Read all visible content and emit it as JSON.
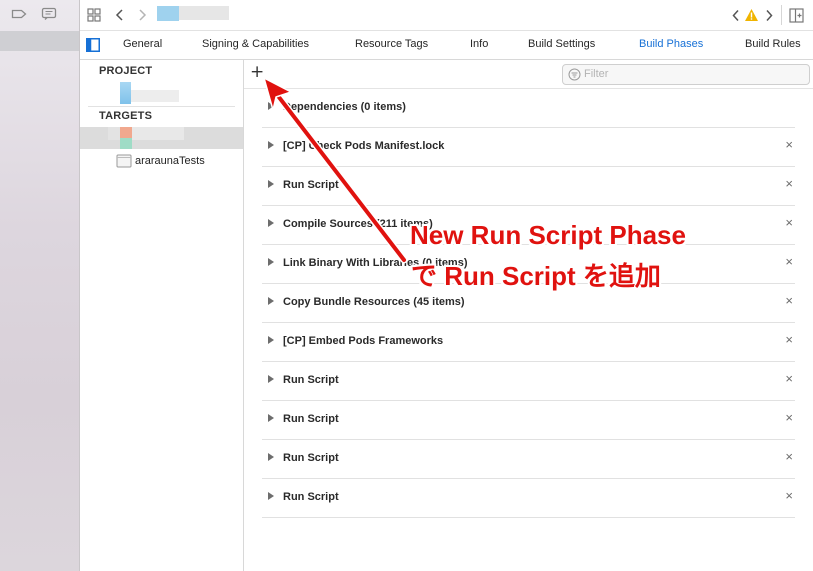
{
  "tabs": [
    {
      "label": "General",
      "active": false
    },
    {
      "label": "Signing & Capabilities",
      "active": false
    },
    {
      "label": "Resource Tags",
      "active": false
    },
    {
      "label": "Info",
      "active": false
    },
    {
      "label": "Build Settings",
      "active": false
    },
    {
      "label": "Build Phases",
      "active": true
    },
    {
      "label": "Build Rules",
      "active": false
    }
  ],
  "sidebar": {
    "project_header": "PROJECT",
    "targets_header": "TARGETS",
    "test_target": "ararаunaTests"
  },
  "toolbar": {
    "add_label": "+",
    "filter_placeholder": "Filter"
  },
  "phases": [
    {
      "label": "Dependencies (0 items)"
    },
    {
      "label": "[CP] Check Pods Manifest.lock"
    },
    {
      "label": "Run Script"
    },
    {
      "label": "Compile Sources (211 items)"
    },
    {
      "label": "Link Binary With Libraries (0 items)"
    },
    {
      "label": "Copy Bundle Resources (45 items)"
    },
    {
      "label": "[CP] Embed Pods Frameworks"
    },
    {
      "label": "Run Script"
    },
    {
      "label": "Run Script"
    },
    {
      "label": "Run Script"
    },
    {
      "label": "Run Script"
    }
  ],
  "remove_glyph": "×",
  "annotation": {
    "line1": "New Run Script Phase",
    "line2": "で Run Script を追加"
  },
  "colors": {
    "accent": "#1670d6",
    "annotation_red": "#e0120f",
    "warning": "#f0b400"
  }
}
